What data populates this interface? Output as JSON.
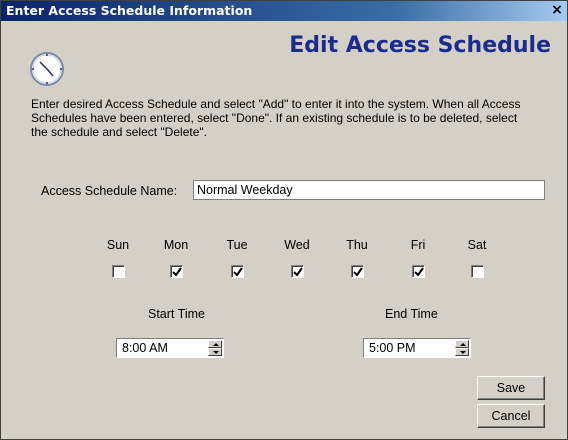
{
  "window": {
    "title": "Enter Access Schedule Information",
    "close_glyph": "×"
  },
  "header": {
    "heading": "Edit Access Schedule",
    "icon": "clock-icon",
    "heading_color": "#1a2c8c"
  },
  "instructions": "Enter desired Access Schedule and select \"Add\" to enter it into the system. When all Access Schedules have been entered, select \"Done\". If an existing schedule is to be deleted, select the schedule and select \"Delete\".",
  "schedule_name": {
    "label": "Access Schedule Name:",
    "value": "Normal Weekday"
  },
  "days": [
    {
      "label": "Sun",
      "checked": false
    },
    {
      "label": "Mon",
      "checked": true
    },
    {
      "label": "Tue",
      "checked": true
    },
    {
      "label": "Wed",
      "checked": true
    },
    {
      "label": "Thu",
      "checked": true
    },
    {
      "label": "Fri",
      "checked": true
    },
    {
      "label": "Sat",
      "checked": false
    }
  ],
  "start_time": {
    "label": "Start Time",
    "value": "8:00 AM"
  },
  "end_time": {
    "label": "End Time",
    "value": "5:00 PM"
  },
  "buttons": {
    "save": "Save",
    "cancel": "Cancel"
  }
}
